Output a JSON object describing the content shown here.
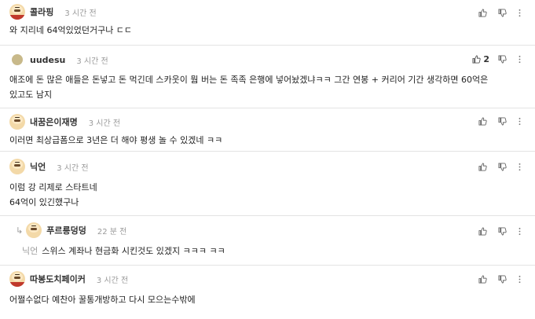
{
  "comments": [
    {
      "author": "콜라핑",
      "time": "3 시간 전",
      "lines": "와 지리네 64억있었던거구나 ㄷㄷ",
      "likes": ""
    },
    {
      "author": "uudesu",
      "time": "3 시간 전",
      "lines": "애조에 돈 많은 애들은 돈넣고 돈 먹긴데 스카웃이 뭠 버는 돈 족족 은행에 넣어놨겠냐ㅋㅋ 그간 연봉 + 커리어 기간 생각하면 60억은\n있고도 남지",
      "likes": "2"
    },
    {
      "author": "내꿈은이재명",
      "time": "3 시간 전",
      "lines": "이러면 최상급폼으로 3년은 더 해야 평생 놀 수 있겠네 ㅋㅋ",
      "likes": ""
    },
    {
      "author": "닉언",
      "time": "3 시간 전",
      "lines": "이럼 강 리제로 스타트네\n64억이 있긴했구나",
      "likes": ""
    },
    {
      "author": "푸르릉덩덩",
      "time": "22 분 전",
      "reply_arrow": "↳",
      "mention": "닉언",
      "lines": "스위스 계좌나 현금화 시킨것도 있겠지 ㅋㅋㅋ ㅋㅋ",
      "likes": ""
    },
    {
      "author": "따봉도치페이커",
      "time": "3 시간 전",
      "lines": "어쩔수없다 예찬아 꿀통개방하고 다시 모으는수밖에",
      "likes": ""
    }
  ]
}
